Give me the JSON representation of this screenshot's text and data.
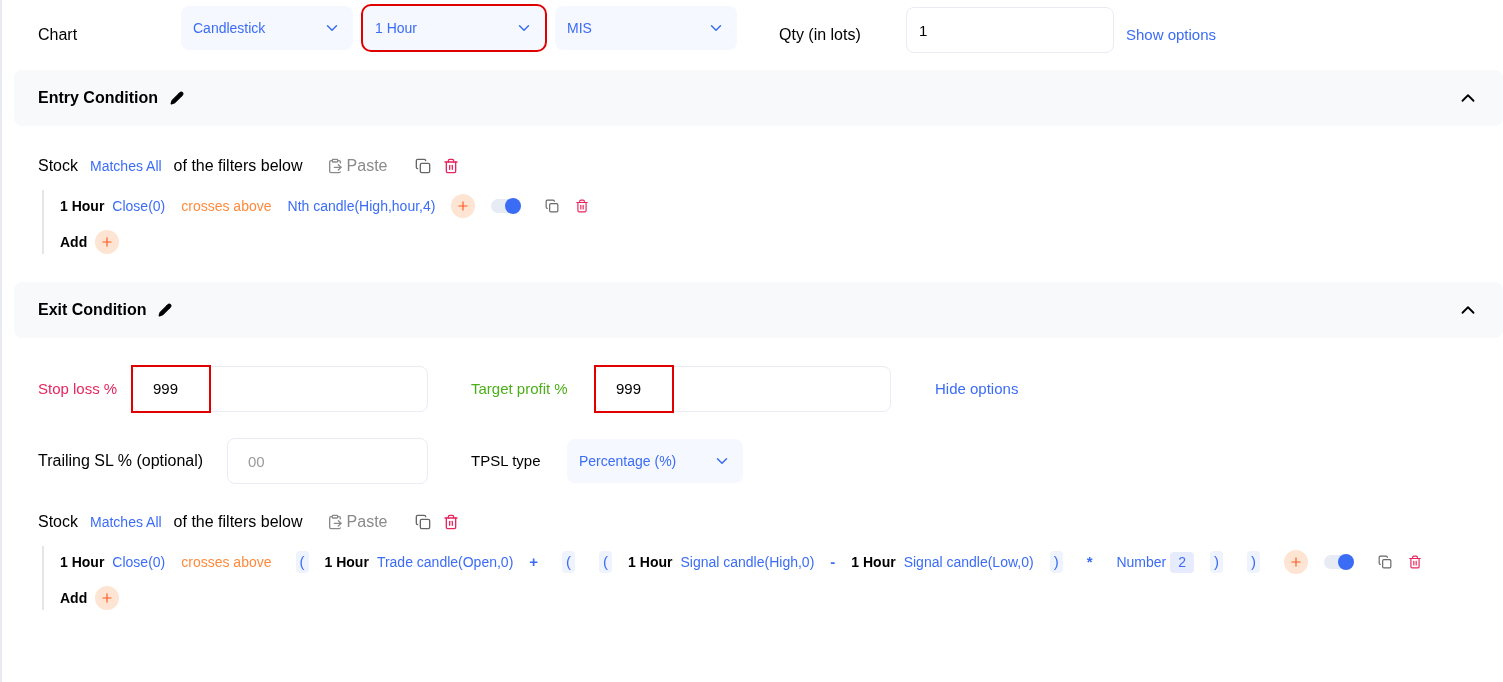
{
  "chart_row": {
    "label": "Chart",
    "selects": [
      {
        "value": "Candlestick",
        "highlighted": false
      },
      {
        "value": "1 Hour",
        "highlighted": true
      },
      {
        "value": "MIS",
        "highlighted": false
      }
    ],
    "qty_label": "Qty (in lots)",
    "qty_value": "1",
    "options_link": "Show options"
  },
  "entry": {
    "title": "Entry Condition",
    "expanded": true,
    "stock": "Stock",
    "match": "Matches All",
    "suffix": "of the filters below",
    "paste": "Paste",
    "filters": [
      {
        "on": true,
        "tokens": [
          {
            "kind": "timeframe",
            "text": "1 Hour"
          },
          {
            "kind": "indicator",
            "text": "Close(0)"
          },
          {
            "kind": "comparator",
            "text": "crosses above"
          },
          {
            "kind": "indicator",
            "text": "Nth candle(High,hour,4)"
          }
        ]
      }
    ],
    "add": "Add"
  },
  "exit": {
    "title": "Exit Condition",
    "expanded": true,
    "stop_loss": {
      "label": "Stop loss %",
      "value": "999",
      "highlighted": true
    },
    "target": {
      "label": "Target profit %",
      "value": "999",
      "highlighted": true
    },
    "options_link": "Hide options",
    "trailing": {
      "label": "Trailing SL % (optional)",
      "placeholder": "00"
    },
    "tpsl": {
      "label": "TPSL type",
      "value": "Percentage (%)"
    },
    "stock": "Stock",
    "match": "Matches All",
    "suffix": "of the filters below",
    "paste": "Paste",
    "filters": [
      {
        "on": true,
        "tokens": [
          {
            "kind": "timeframe",
            "text": "1 Hour"
          },
          {
            "kind": "indicator",
            "text": "Close(0)"
          },
          {
            "kind": "comparator",
            "text": "crosses above"
          },
          {
            "kind": "paren",
            "text": "("
          },
          {
            "kind": "timeframe",
            "text": "1 Hour"
          },
          {
            "kind": "indicator",
            "text": "Trade candle(Open,0)"
          },
          {
            "kind": "math",
            "text": "+"
          },
          {
            "kind": "paren",
            "text": "("
          },
          {
            "kind": "paren",
            "text": "("
          },
          {
            "kind": "timeframe",
            "text": "1 Hour"
          },
          {
            "kind": "indicator",
            "text": "Signal candle(High,0)"
          },
          {
            "kind": "math",
            "text": "-"
          },
          {
            "kind": "timeframe",
            "text": "1 Hour"
          },
          {
            "kind": "indicator",
            "text": "Signal candle(Low,0)"
          },
          {
            "kind": "paren",
            "text": ")"
          },
          {
            "kind": "math",
            "text": "*"
          },
          {
            "kind": "number",
            "text": "Number",
            "value": "2"
          },
          {
            "kind": "paren",
            "text": ")"
          },
          {
            "kind": "paren",
            "text": ")"
          }
        ]
      }
    ],
    "add": "Add"
  }
}
